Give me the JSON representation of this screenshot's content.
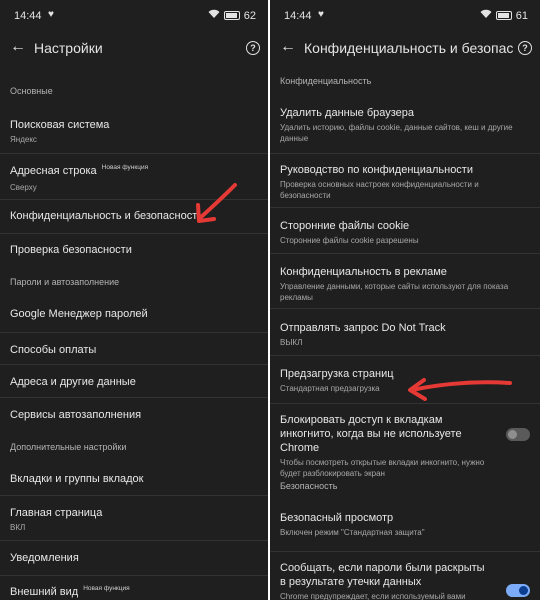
{
  "left": {
    "status": {
      "time": "14:44",
      "battery": "62"
    },
    "appbar": {
      "title": "Настройки"
    },
    "items": [
      {
        "label": "Основные"
      },
      {
        "label": "Поисковая система",
        "sub": "Яндекс"
      },
      {
        "label": "Адресная строка",
        "badge": "Новая функция",
        "sub": "Сверху"
      },
      {
        "label": "Конфиденциальность и безопасность"
      },
      {
        "label": "Проверка безопасности"
      },
      {
        "label": "Пароли и автозаполнение"
      },
      {
        "label": "Google Менеджер паролей"
      },
      {
        "label": "Способы оплаты"
      },
      {
        "label": "Адреса и другие данные"
      },
      {
        "label": "Сервисы автозаполнения"
      },
      {
        "label": "Дополнительные настройки"
      },
      {
        "label": "Вкладки и группы вкладок"
      },
      {
        "label": "Главная страница",
        "sub": "ВКЛ"
      },
      {
        "label": "Уведомления"
      },
      {
        "label": "Внешний вид",
        "badge": "Новая функция"
      }
    ]
  },
  "right": {
    "status": {
      "time": "14:44",
      "battery": "61"
    },
    "appbar": {
      "title": "Конфиденциальность и безопас..."
    },
    "items": [
      {
        "label": "Конфиденциальность"
      },
      {
        "label": "Удалить данные браузера",
        "sub": "Удалить историю, файлы cookie, данные сайтов, кеш и другие данные"
      },
      {
        "label": "Руководство по конфиденциальности",
        "sub": "Проверка основных настроек конфиденциальности и безопасности"
      },
      {
        "label": "Сторонние файлы cookie",
        "sub": "Сторонние файлы cookie разрешены"
      },
      {
        "label": "Конфиденциальность в рекламе",
        "sub": "Управление данными, которые сайты используют для показа рекламы"
      },
      {
        "label": "Отправлять запрос Do Not Track",
        "sub": "ВЫКЛ"
      },
      {
        "label": "Предзагрузка страниц",
        "sub": "Стандартная предзагрузка"
      },
      {
        "label": "Блокировать доступ к вкладкам инкогнито, когда вы не используете Chrome",
        "sub": "Чтобы посмотреть открытые вкладки инкогнито, нужно будет разблокировать экран",
        "toggle": false
      },
      {
        "label": "Безопасность"
      },
      {
        "label": "Безопасный просмотр",
        "sub": "Включен режим \"Стандартная защита\""
      },
      {
        "label": "Сообщать, если пароли были раскрыты в результате утечки данных",
        "sub": "Chrome предупреждает, если используемый вами пароль был раскрыт в интернете. При этом ваши",
        "toggle": true
      }
    ]
  },
  "colors": {
    "background": "#1f1f1f",
    "text": "#e3e3e3",
    "secondary": "#a8a8a8",
    "arrow": "#e53935",
    "toggle_on": "#7cacf8"
  }
}
